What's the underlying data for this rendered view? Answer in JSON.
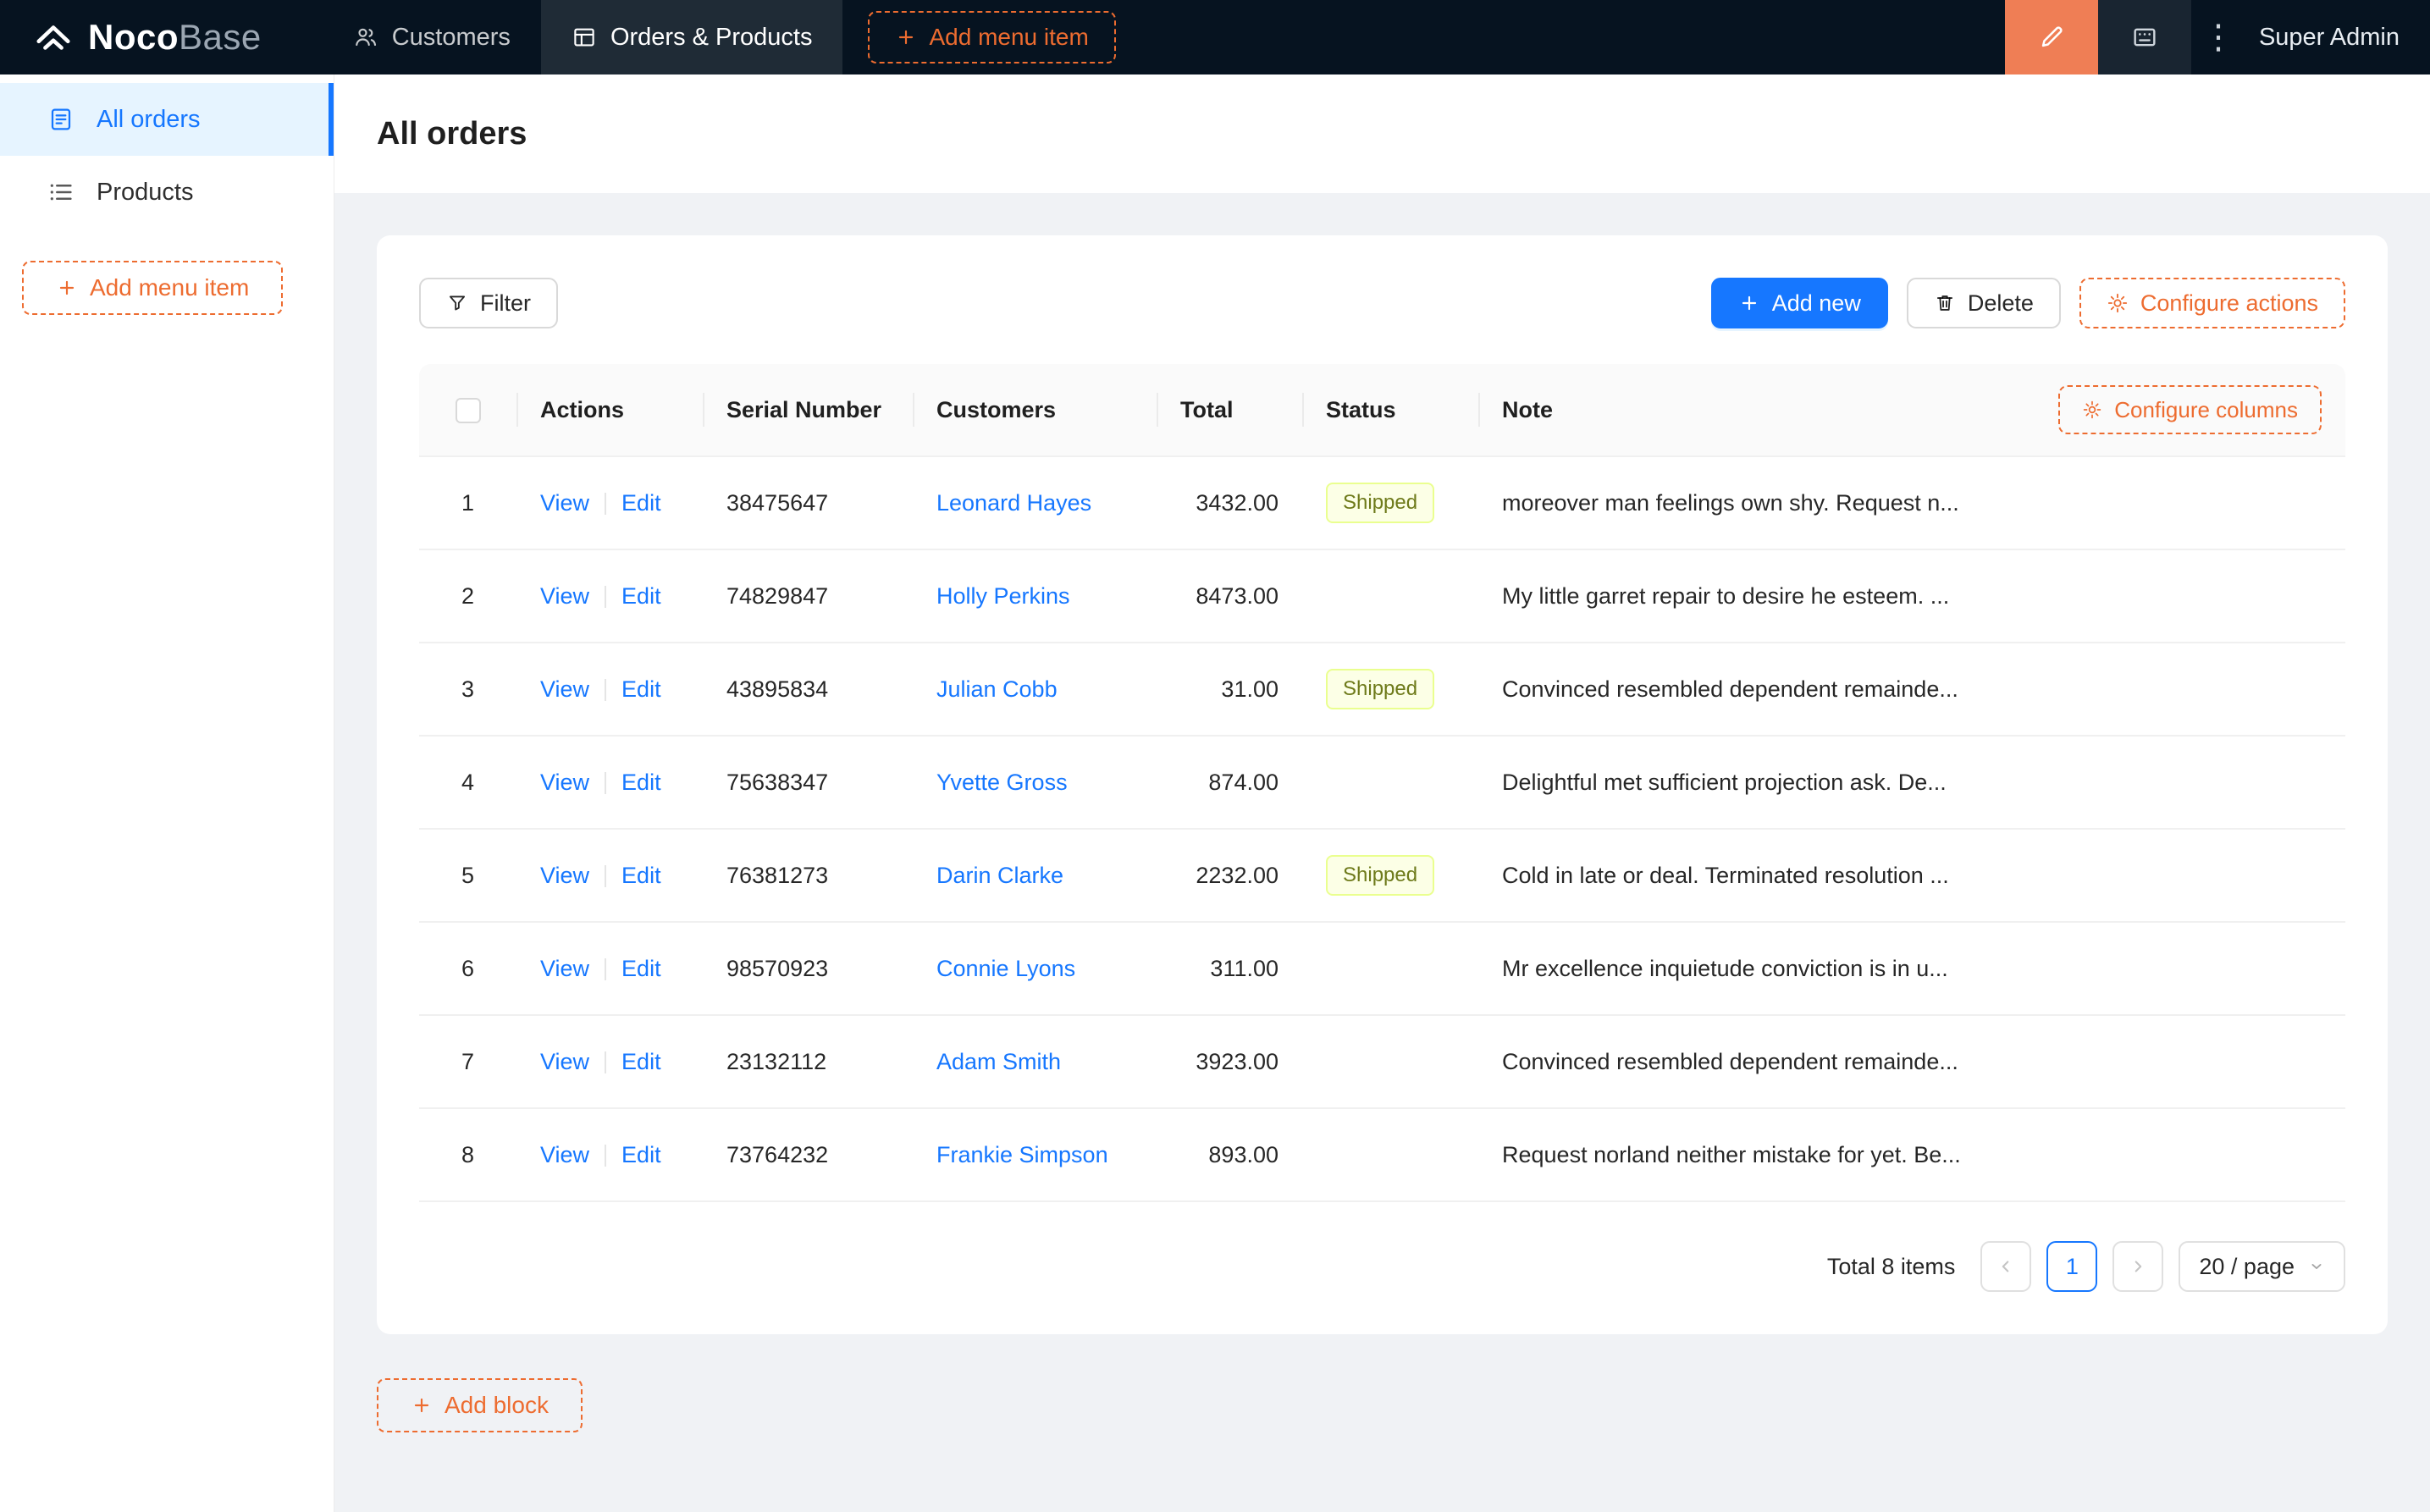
{
  "colors": {
    "header_bg": "#061320",
    "accent_orange": "#ED6C30",
    "designer_orange": "#EF7E55",
    "primary_blue": "#1677FF",
    "sidebar_active_bg": "#E6F4FF",
    "tag_bg": "#FCFFE6",
    "tag_border": "#EAFF8F",
    "tag_text": "#6E7A1A"
  },
  "header": {
    "brand_bold": "Noco",
    "brand_light": "Base",
    "tabs": [
      {
        "label": "Customers"
      },
      {
        "label": "Orders & Products"
      }
    ],
    "add_menu_item_label": "Add menu item",
    "more_icon": "⋮",
    "user_label": "Super Admin"
  },
  "sidebar": {
    "items": [
      {
        "label": "All orders"
      },
      {
        "label": "Products"
      }
    ],
    "add_menu_item_label": "Add menu item"
  },
  "page": {
    "title": "All orders",
    "add_block_label": "Add block"
  },
  "toolbar": {
    "filter_label": "Filter",
    "add_new_label": "Add new",
    "delete_label": "Delete",
    "configure_actions_label": "Configure actions"
  },
  "table": {
    "configure_columns_label": "Configure columns",
    "columns": {
      "actions": "Actions",
      "serial": "Serial Number",
      "customers": "Customers",
      "total": "Total",
      "status": "Status",
      "note": "Note"
    },
    "action_labels": {
      "view": "View",
      "edit": "Edit"
    },
    "rows": [
      {
        "index": 1,
        "serial": "38475647",
        "customer": "Leonard Hayes",
        "total": "3432.00",
        "status": "Shipped",
        "note": "moreover man feelings own shy. Request n..."
      },
      {
        "index": 2,
        "serial": "74829847",
        "customer": "Holly Perkins",
        "total": "8473.00",
        "status": "",
        "note": "My little garret repair to desire he esteem. ..."
      },
      {
        "index": 3,
        "serial": "43895834",
        "customer": "Julian Cobb",
        "total": "31.00",
        "status": "Shipped",
        "note": "Convinced resembled dependent remainde..."
      },
      {
        "index": 4,
        "serial": "75638347",
        "customer": "Yvette Gross",
        "total": "874.00",
        "status": "",
        "note": "Delightful met sufficient projection ask. De..."
      },
      {
        "index": 5,
        "serial": "76381273",
        "customer": "Darin Clarke",
        "total": "2232.00",
        "status": "Shipped",
        "note": "Cold in late or deal. Terminated resolution ..."
      },
      {
        "index": 6,
        "serial": "98570923",
        "customer": "Connie Lyons",
        "total": "311.00",
        "status": "",
        "note": "Mr excellence inquietude conviction is in u..."
      },
      {
        "index": 7,
        "serial": "23132112",
        "customer": "Adam Smith",
        "total": "3923.00",
        "status": "",
        "note": "Convinced resembled dependent remainde..."
      },
      {
        "index": 8,
        "serial": "73764232",
        "customer": "Frankie Simpson",
        "total": "893.00",
        "status": "",
        "note": "Request norland neither mistake for yet. Be..."
      }
    ]
  },
  "pagination": {
    "total_text": "Total 8 items",
    "current_page": "1",
    "page_size_label": "20 / page"
  }
}
